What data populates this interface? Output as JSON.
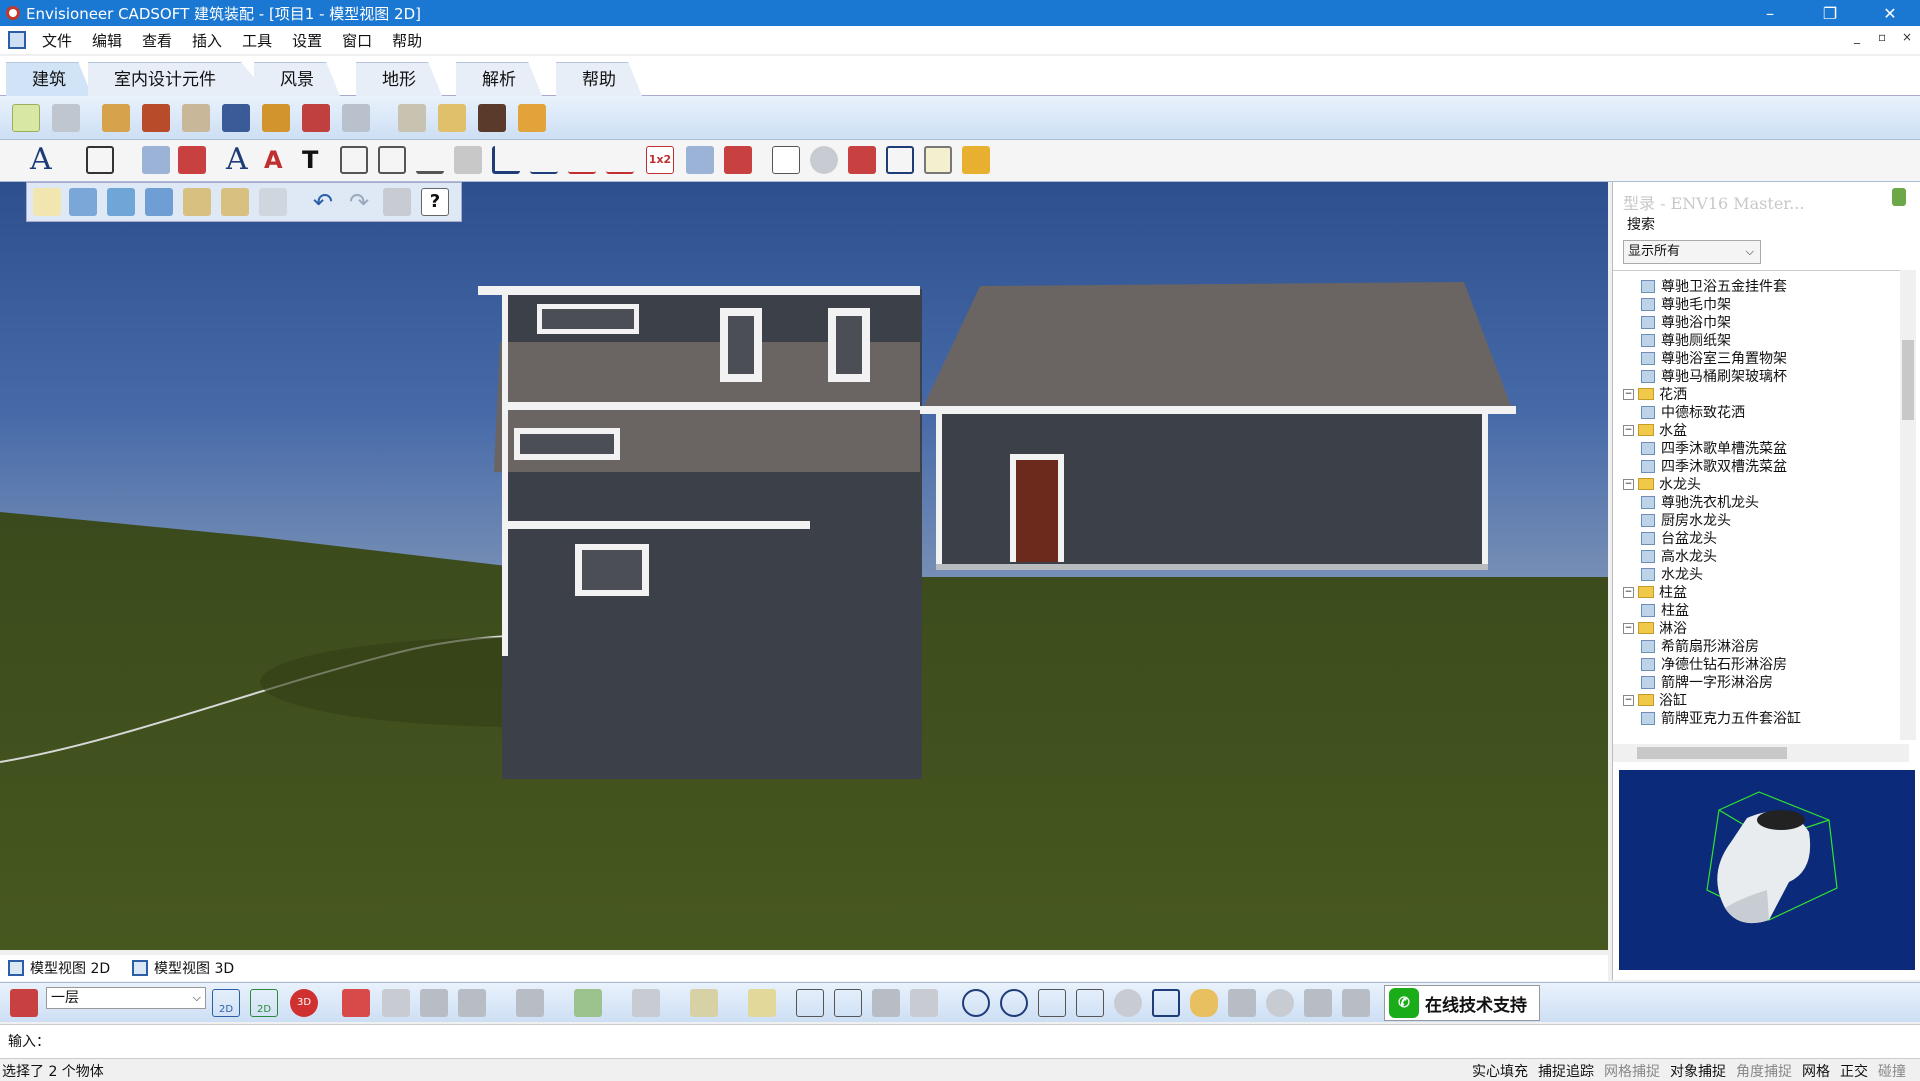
{
  "window": {
    "title": "Envisioneer CADSOFT 建筑装配 - [项目1 - 模型视图 2D]",
    "minimize": "–",
    "restore": "❐",
    "close": "✕"
  },
  "menu": [
    "文件",
    "编辑",
    "查看",
    "插入",
    "工具",
    "设置",
    "窗口",
    "帮助"
  ],
  "mdi_controls": [
    "_",
    "▫",
    "×"
  ],
  "ribbon_tabs": [
    "建筑",
    "室内设计元件",
    "风景",
    "地形",
    "解析",
    "帮助"
  ],
  "catalog": {
    "title": "型录 - ENV16 Master...",
    "search_label": "搜索",
    "filter_value": "显示所有",
    "tree": [
      {
        "level": 2,
        "type": "item",
        "label": "尊驰卫浴五金挂件套"
      },
      {
        "level": 2,
        "type": "item",
        "label": "尊驰毛巾架"
      },
      {
        "level": 2,
        "type": "item",
        "label": "尊驰浴巾架"
      },
      {
        "level": 2,
        "type": "item",
        "label": "尊驰厕纸架"
      },
      {
        "level": 2,
        "type": "item",
        "label": "尊驰浴室三角置物架"
      },
      {
        "level": 2,
        "type": "item",
        "label": "尊驰马桶刷架玻璃杯"
      },
      {
        "level": 1,
        "type": "folder",
        "label": "花洒"
      },
      {
        "level": 2,
        "type": "item",
        "label": "中德标致花洒"
      },
      {
        "level": 1,
        "type": "folder",
        "label": "水盆"
      },
      {
        "level": 2,
        "type": "item",
        "label": "四季沐歌单槽洗菜盆"
      },
      {
        "level": 2,
        "type": "item",
        "label": "四季沐歌双槽洗菜盆"
      },
      {
        "level": 1,
        "type": "folder",
        "label": "水龙头"
      },
      {
        "level": 2,
        "type": "item",
        "label": "尊驰洗衣机龙头"
      },
      {
        "level": 2,
        "type": "item",
        "label": "厨房水龙头"
      },
      {
        "level": 2,
        "type": "item",
        "label": "台盆龙头"
      },
      {
        "level": 2,
        "type": "item",
        "label": "高水龙头"
      },
      {
        "level": 2,
        "type": "item",
        "label": "水龙头"
      },
      {
        "level": 1,
        "type": "folder",
        "label": "柱盆"
      },
      {
        "level": 2,
        "type": "item",
        "label": "柱盆"
      },
      {
        "level": 1,
        "type": "folder",
        "label": "淋浴"
      },
      {
        "level": 2,
        "type": "item",
        "label": "希箭扇形淋浴房"
      },
      {
        "level": 2,
        "type": "item",
        "label": "净德仕钻石形淋浴房"
      },
      {
        "level": 2,
        "type": "item",
        "label": "箭牌一字形淋浴房"
      },
      {
        "level": 1,
        "type": "folder",
        "label": "浴缸"
      },
      {
        "level": 2,
        "type": "item",
        "label": "箭牌亚克力五件套浴缸"
      }
    ]
  },
  "view_tabs": [
    "模型视图 2D",
    "模型视图 3D"
  ],
  "layer_value": "一层",
  "support_label": "在线技术支持",
  "command_prompt": "输入：",
  "status": {
    "selection": "选择了 2 个物体",
    "toggles": [
      {
        "label": "实心填充",
        "on": true
      },
      {
        "label": "捕捉追踪",
        "on": true
      },
      {
        "label": "网格捕捉",
        "on": false
      },
      {
        "label": "对象捕捉",
        "on": true
      },
      {
        "label": "角度捕捉",
        "on": false
      },
      {
        "label": "网格",
        "on": true
      },
      {
        "label": "正交",
        "on": true
      },
      {
        "label": "碰撞",
        "on": false
      }
    ]
  },
  "colors": {
    "titlebar": "#1b78d2",
    "sky": "#3a5f9c",
    "grass": "#3d4f1c",
    "siding": "#3b4049",
    "roof": "#6a6462",
    "preview_bg": "#0b2a7a"
  }
}
